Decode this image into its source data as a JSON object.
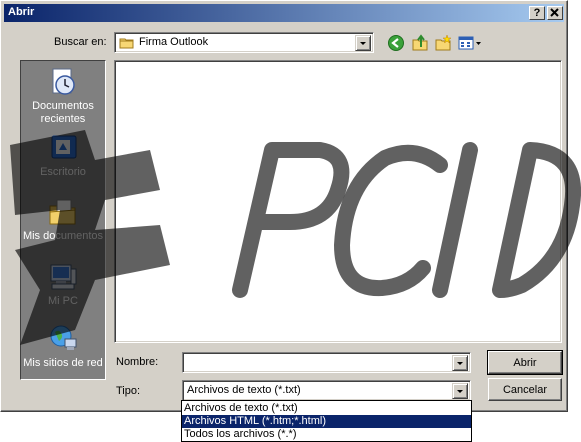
{
  "window": {
    "title": "Abrir",
    "help_button": "?",
    "close_button": "x"
  },
  "lookin": {
    "label": "Buscar en:",
    "value": "Firma Outlook"
  },
  "toolbar": {
    "back_icon": "back-arrow-icon",
    "up_icon": "up-folder-icon",
    "newfolder_icon": "new-folder-icon",
    "views_icon": "views-menu-icon"
  },
  "places": [
    {
      "label": "Documentos recientes",
      "icon": "recent-documents-icon"
    },
    {
      "label": "Escritorio",
      "icon": "desktop-icon"
    },
    {
      "label": "Mis documentos",
      "icon": "my-documents-icon"
    },
    {
      "label": "Mi PC",
      "icon": "my-computer-icon"
    },
    {
      "label": "Mis sitios de red",
      "icon": "network-places-icon"
    }
  ],
  "filename": {
    "label": "Nombre:",
    "value": ""
  },
  "filetype": {
    "label": "Tipo:",
    "value": "Archivos de texto (*.txt)",
    "options": [
      "Archivos de texto (*.txt)",
      "Archivos HTML (*.htm;*.html)",
      "Todos los archivos (*.*)"
    ],
    "highlighted_index": 1
  },
  "buttons": {
    "open": "Abrir",
    "cancel": "Cancelar"
  },
  "watermark": {
    "text": "PCID"
  },
  "colors": {
    "titlebar_start": "#0a246a",
    "titlebar_end": "#a6caf0",
    "selection": "#0a246a",
    "face": "#d4d0c8",
    "places_bar": "#808080"
  }
}
